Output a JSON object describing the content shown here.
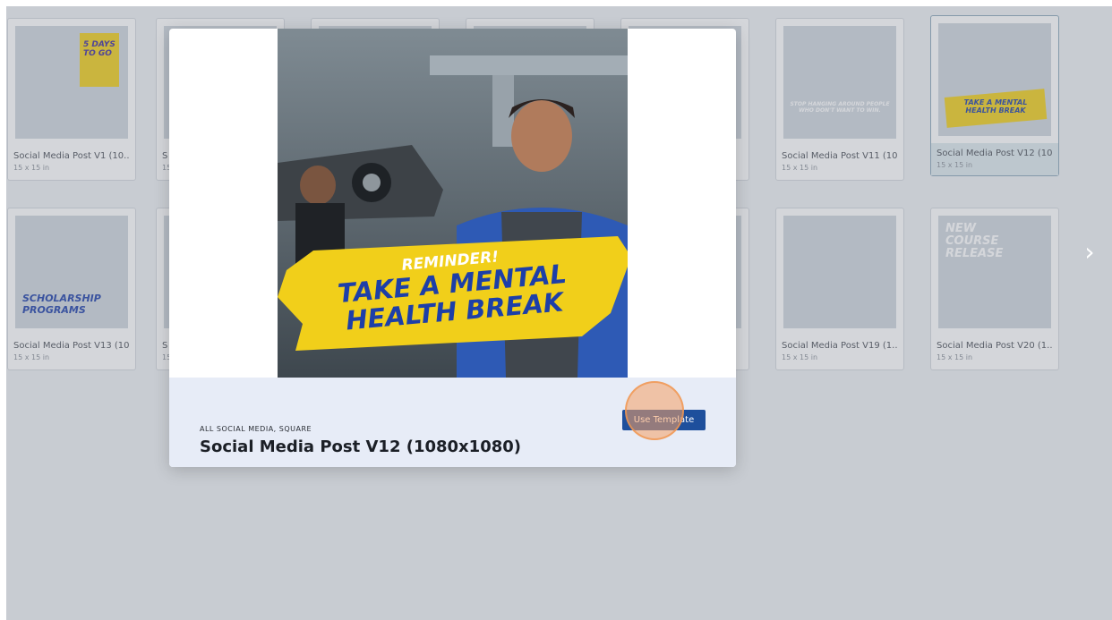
{
  "colors": {
    "accent": "#1e4f9c",
    "banner_yellow": "#f1cf1a",
    "banner_text_blue": "#1d3fa8",
    "footer_bg": "#e7ecf7"
  },
  "grid": {
    "cards": [
      {
        "name": "Social Media Post V1 (10...",
        "size": "15 x 15 in",
        "thumb_text": "5 DAYS TO GO"
      },
      {
        "name": "S",
        "size": "15",
        "thumb_text": ""
      },
      {
        "name": "",
        "size": "",
        "thumb_text": ""
      },
      {
        "name": "",
        "size": "",
        "thumb_text": ""
      },
      {
        "name": "",
        "size": "",
        "thumb_text": ""
      },
      {
        "name": "Social Media Post V11 (10...",
        "size": "15 x 15 in",
        "thumb_text": "STOP HANGING AROUND PEOPLE WHO DON'T WANT TO WIN."
      },
      {
        "name": "Social Media Post V12 (10...",
        "size": "15 x 15 in",
        "thumb_text": "TAKE A MENTAL HEALTH BREAK"
      },
      {
        "name": "Social Media Post V13 (10...",
        "size": "15 x 15 in",
        "thumb_text": "SCHOLARSHIP PROGRAMS"
      },
      {
        "name": "S",
        "size": "15",
        "thumb_text": ""
      },
      {
        "name": "Social Media Post V19 (1...",
        "size": "15 x 15 in",
        "thumb_text": ""
      },
      {
        "name": "Social Media Post V20 (1...",
        "size": "15 x 15 in",
        "thumb_text": "NEW COURSE RELEASE"
      }
    ],
    "next_arrow": "›"
  },
  "modal": {
    "preview": {
      "banner_top": "REMINDER!",
      "banner_line1": "TAKE A MENTAL",
      "banner_line2": "HEALTH BREAK"
    },
    "category": "ALL SOCIAL MEDIA, SQUARE",
    "title": "Social Media Post V12 (1080x1080)",
    "use_button": "Use Template"
  }
}
